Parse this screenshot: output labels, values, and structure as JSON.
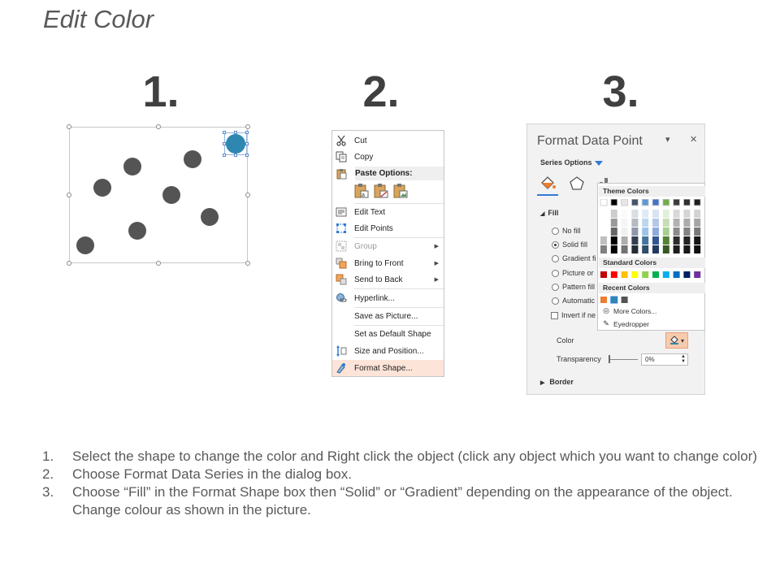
{
  "title": "Edit Color",
  "step_numbers": [
    "1.",
    "2.",
    "3."
  ],
  "context_menu": {
    "items": [
      {
        "label": "Cut",
        "icon": "scissors-icon"
      },
      {
        "label": "Copy",
        "icon": "copy-icon"
      },
      {
        "label": "Paste Options:",
        "icon": "clipboard-icon"
      },
      {
        "label": "Edit Text",
        "icon": "edit-text-icon"
      },
      {
        "label": "Edit Points",
        "icon": "edit-points-icon"
      },
      {
        "label": "Group",
        "icon": "group-icon"
      },
      {
        "label": "Bring to Front",
        "icon": "bring-front-icon"
      },
      {
        "label": "Send to Back",
        "icon": "send-back-icon"
      },
      {
        "label": "Hyperlink...",
        "icon": "hyperlink-icon"
      },
      {
        "label": "Save as Picture..."
      },
      {
        "label": "Set as Default Shape"
      },
      {
        "label": "Size and Position...",
        "icon": "size-position-icon"
      },
      {
        "label": "Format Shape...",
        "icon": "format-shape-icon"
      }
    ]
  },
  "format_pane": {
    "title": "Format Data Point",
    "menu_glyph": "▾",
    "close_glyph": "✕",
    "series_options": "Series Options",
    "fill_section": "Fill",
    "fill_options": [
      "No fill",
      "Solid fill",
      "Gradient fi",
      "Picture or",
      "Pattern fill",
      "Automatic"
    ],
    "invert_label": "Invert if ne",
    "color_label": "Color",
    "transparency_label": "Transparency",
    "transparency_value": "0%",
    "border_section": "Border"
  },
  "color_dropdown": {
    "theme_colors_label": "Theme Colors",
    "standard_colors_label": "Standard Colors",
    "recent_colors_label": "Recent Colors",
    "more_colors": "More Colors...",
    "eyedropper": "Eyedropper",
    "theme_top": [
      "#ffffff",
      "#000000",
      "#e7e6e6",
      "#44546a",
      "#5b9bd5",
      "#4472c4",
      "#70ad47",
      "#3c3c3c",
      "#2f2f2f",
      "#1f1f1f"
    ],
    "standard": [
      "#c00000",
      "#ff0000",
      "#ffc000",
      "#ffff00",
      "#92d050",
      "#00b050",
      "#00b0f0",
      "#0070c0",
      "#002060",
      "#7030a0"
    ],
    "recent": [
      "#ed7d31",
      "#2e87b0",
      "#545454"
    ]
  },
  "instructions": [
    {
      "num": "1.",
      "text": "Select the shape to change the color and Right click the object (click any object which you want to change color)"
    },
    {
      "num": "2.",
      "text": "Choose Format Data Series in the dialog box."
    },
    {
      "num": "3.",
      "text": "Choose “Fill” in the Format Shape box then “Solid” or “Gradient” depending on the appearance of the object. Change colour as shown in the picture."
    }
  ]
}
